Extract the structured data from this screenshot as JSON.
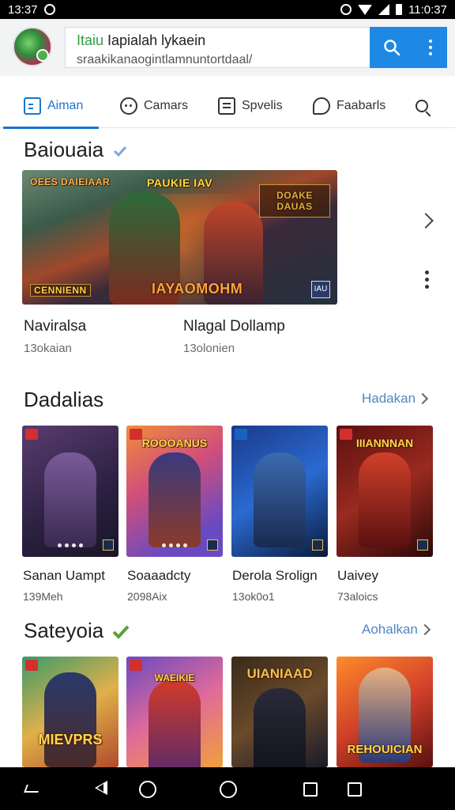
{
  "status_bar": {
    "time": "13:37",
    "time_right": "11:0:37"
  },
  "search": {
    "title_accent": "Itaiu",
    "title_rest": " Iapialah lykaein",
    "subtitle": "sraakikanaogintlamnuntortdaal/"
  },
  "tabs": [
    {
      "label": "Aiman",
      "icon": "list-icon"
    },
    {
      "label": "Camars",
      "icon": "chat-icon"
    },
    {
      "label": "Spvelis",
      "icon": "document-icon"
    },
    {
      "label": "Faabarls",
      "icon": "bubble-icon"
    },
    {
      "label": "",
      "icon": "search-icon"
    }
  ],
  "featured": {
    "title": "Baiouaia",
    "banner": {
      "top_left": "OEES DAIEIAAR",
      "top_middle": "PAUKIE IAV",
      "top_right": "DOAKE DAUAS",
      "bottom_left": "CENNIENN",
      "bottom_middle": "IAYAOMOHM",
      "logo": "IAU"
    },
    "items": [
      {
        "title": "Naviralsa",
        "subtitle": "13okaian"
      },
      {
        "title": "Nlagal Dollamp",
        "subtitle": "13olonien"
      }
    ]
  },
  "section2": {
    "title": "Dadalias",
    "see_more": "Hadakan",
    "items": [
      {
        "title": "Sanan Uampt",
        "subtitle": "139Meh",
        "tile_text": ""
      },
      {
        "title": "Soaaadcty",
        "subtitle": "2098Aix",
        "tile_text": "ROOOANUS"
      },
      {
        "title": "Derola Srolign",
        "subtitle": "13ok0o1",
        "tile_text": ""
      },
      {
        "title": "Uaivey",
        "subtitle": "73aloics",
        "tile_text": "IIIANNNAN"
      }
    ]
  },
  "section3": {
    "title": "Sateyoia",
    "see_more": "Aohalkan",
    "tiles": [
      {
        "tile_text": "MIEVPRS"
      },
      {
        "tile_text": "WAEIKIE"
      },
      {
        "tile_text": "UIANIAAD"
      },
      {
        "tile_text": "REHOUICIAN"
      }
    ]
  },
  "colors": {
    "accent": "#1976d2",
    "search_button": "#1e88e5",
    "link": "#4f86c0"
  }
}
